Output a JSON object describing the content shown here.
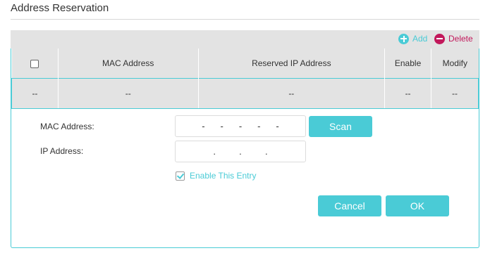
{
  "section_title": "Address Reservation",
  "toolbar": {
    "add_label": "Add",
    "delete_label": "Delete"
  },
  "table": {
    "columns": [
      "",
      "MAC Address",
      "Reserved IP Address",
      "Enable",
      "Modify"
    ],
    "rows": [
      [
        "--",
        "--",
        "--",
        "--",
        "--"
      ]
    ]
  },
  "form": {
    "mac_label": "MAC Address:",
    "mac_separators": [
      "-",
      "-",
      "-",
      "-",
      "-"
    ],
    "scan_label": "Scan",
    "ip_label": "IP Address:",
    "ip_separators": [
      ".",
      ".",
      "."
    ],
    "enable_label": "Enable This Entry",
    "enable_checked": true,
    "cancel_label": "Cancel",
    "ok_label": "OK"
  },
  "colors": {
    "accent": "#4acbd6",
    "delete": "#c2185b",
    "header_bg": "#e3e3e3"
  }
}
